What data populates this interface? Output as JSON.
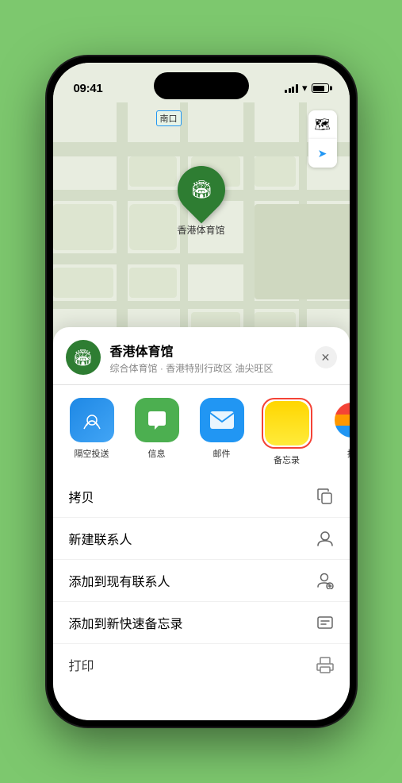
{
  "status_bar": {
    "time": "09:41",
    "location_icon": "▲"
  },
  "map": {
    "label_text": "南口",
    "pin_label": "香港体育馆",
    "stadium_icon": "🏟"
  },
  "map_controls": {
    "map_btn": "🗺",
    "location_btn": "◎"
  },
  "sheet": {
    "title": "香港体育馆",
    "subtitle": "综合体育馆 · 香港特别行政区 油尖旺区",
    "close_btn": "✕"
  },
  "apps": [
    {
      "id": "airdrop",
      "label": "隔空投送",
      "icon_type": "airdrop"
    },
    {
      "id": "messages",
      "label": "信息",
      "icon_type": "messages"
    },
    {
      "id": "mail",
      "label": "邮件",
      "icon_type": "mail"
    },
    {
      "id": "notes",
      "label": "备忘录",
      "icon_type": "notes"
    },
    {
      "id": "more",
      "label": "提",
      "icon_type": "more"
    }
  ],
  "actions": [
    {
      "id": "copy",
      "label": "拷贝",
      "icon": "⎘"
    },
    {
      "id": "new-contact",
      "label": "新建联系人",
      "icon": "👤"
    },
    {
      "id": "add-contact",
      "label": "添加到现有联系人",
      "icon": "👤"
    },
    {
      "id": "add-notes",
      "label": "添加到新快速备忘录",
      "icon": "📋"
    },
    {
      "id": "print",
      "label": "打印",
      "icon": "🖨"
    }
  ]
}
